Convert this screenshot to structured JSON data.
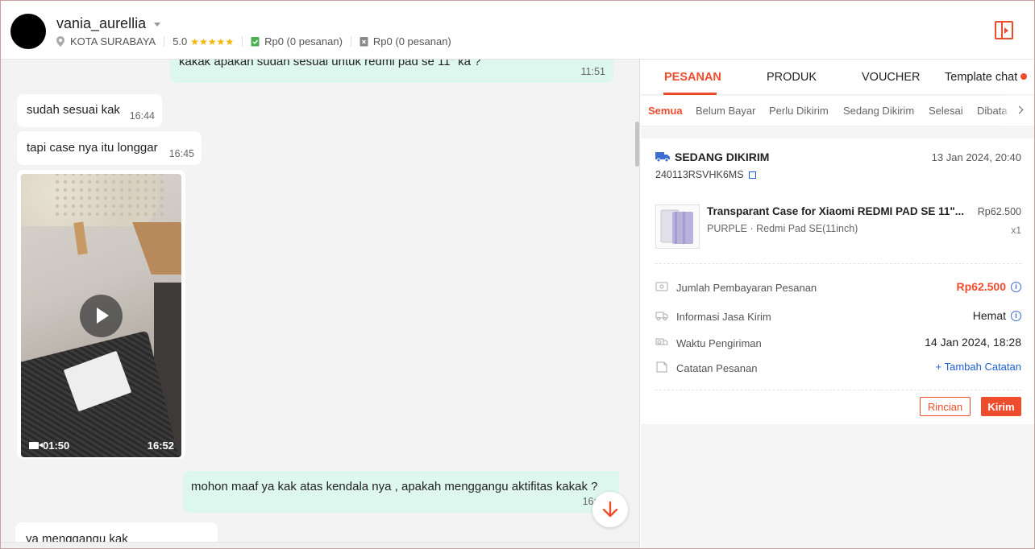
{
  "header": {
    "username": "vania_aurellia",
    "location": "KOTA SURABAYA",
    "rating": "5.0",
    "stars": "★★★★★",
    "stat1": "Rp0 (0 pesanan)",
    "stat2": "Rp0 (0 pesanan)"
  },
  "chat": {
    "messages": [
      {
        "text": "kakak apakah sudah sesuai untuk redmi pad se 11\" ka ?",
        "time": "11:51",
        "side": "out"
      },
      {
        "text": "sudah sesuai kak",
        "time": "16:44",
        "side": "in"
      },
      {
        "text": "tapi case nya itu longgar",
        "time": "16:45",
        "side": "in"
      },
      {
        "text": "mohon maaf ya kak atas kendala nya , apakah menggangu aktifitas kakak ?",
        "time": "16:",
        "side": "out"
      },
      {
        "text": "ya menggangu kak",
        "time": "",
        "side": "in"
      }
    ],
    "video": {
      "duration": "01:50",
      "time": "16:52"
    }
  },
  "panel": {
    "tabs": [
      "PESANAN",
      "PRODUK",
      "VOUCHER",
      "Template chat"
    ],
    "subtabs": [
      "Semua",
      "Belum Bayar",
      "Perlu Dikirim",
      "Sedang Dikirim",
      "Selesai",
      "Dibata"
    ],
    "order": {
      "status": "SEDANG DIKIRIM",
      "date": "13 Jan 2024, 20:40",
      "id": "240113RSVHK6MS",
      "product_name": "Transparant Case for Xiaomi REDMI PAD SE 11\"...",
      "variant": "PURPLE · Redmi Pad SE(11inch)",
      "price": "Rp62.500",
      "qty": "x1",
      "rows": [
        {
          "label": "Jumlah Pembayaran Pesanan",
          "value": "Rp62.500"
        },
        {
          "label": "Informasi Jasa Kirim",
          "value": "Hemat"
        },
        {
          "label": "Waktu Pengiriman",
          "value": "14 Jan 2024, 18:28"
        },
        {
          "label": "Catatan Pesanan",
          "value": "+ Tambah Catatan"
        }
      ],
      "btn_detail": "Rincian",
      "btn_send": "Kirim"
    }
  },
  "colors": {
    "accent": "#ee4d2d",
    "bubble_out": "#def7ee",
    "link": "#1e5fd4"
  }
}
